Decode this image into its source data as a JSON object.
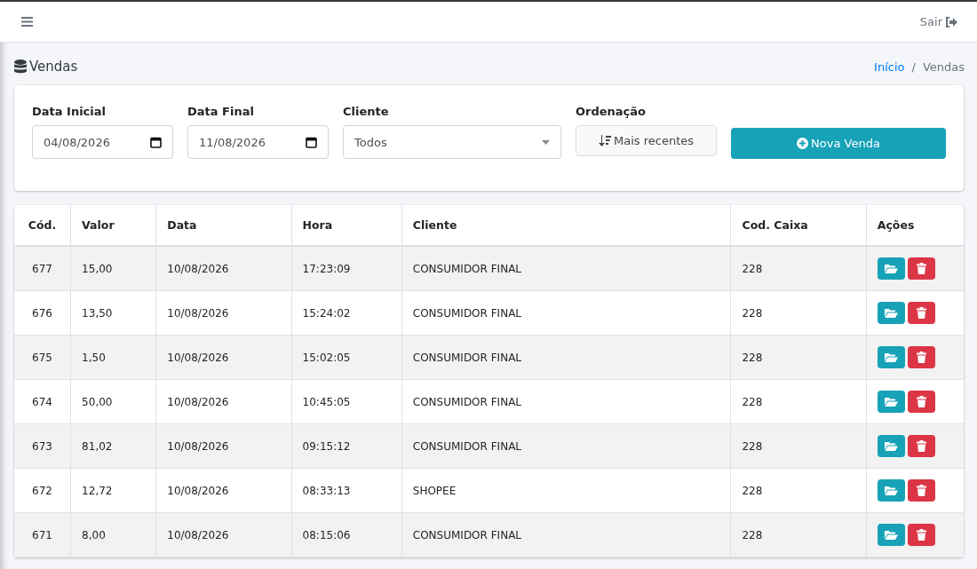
{
  "navbar": {
    "logout": "Sair"
  },
  "page": {
    "title": "Vendas",
    "breadcrumb_separator": "/",
    "breadcrumb": [
      {
        "label": "Início",
        "kind": "link"
      },
      {
        "label": "Vendas",
        "kind": "current"
      }
    ]
  },
  "filters": {
    "start_date": {
      "label": "Data Inicial",
      "value": "04/08/2026"
    },
    "end_date": {
      "label": "Data Final",
      "value": "11/08/2026"
    },
    "client": {
      "label": "Cliente",
      "value": "Todos"
    },
    "ordering": {
      "label": "Ordenação",
      "value": "Mais recentes"
    },
    "new_button": "Nova Venda"
  },
  "table": {
    "columns": [
      "Cód.",
      "Valor",
      "Data",
      "Hora",
      "Cliente",
      "Cod. Caixa",
      "Ações"
    ],
    "rows": [
      [
        "677",
        "15,00",
        "10/08/2026",
        "17:23:09",
        "CONSUMIDOR FINAL",
        "228"
      ],
      [
        "676",
        "13,50",
        "10/08/2026",
        "15:24:02",
        "CONSUMIDOR FINAL",
        "228"
      ],
      [
        "675",
        "1,50",
        "10/08/2026",
        "15:02:05",
        "CONSUMIDOR FINAL",
        "228"
      ],
      [
        "674",
        "50,00",
        "10/08/2026",
        "10:45:05",
        "CONSUMIDOR FINAL",
        "228"
      ],
      [
        "673",
        "81,02",
        "10/08/2026",
        "09:15:12",
        "CONSUMIDOR FINAL",
        "228"
      ],
      [
        "672",
        "12,72",
        "10/08/2026",
        "08:33:13",
        "SHOPEE",
        "228"
      ],
      [
        "671",
        "8,00",
        "10/08/2026",
        "08:15:06",
        "CONSUMIDOR FINAL",
        "228"
      ]
    ]
  }
}
